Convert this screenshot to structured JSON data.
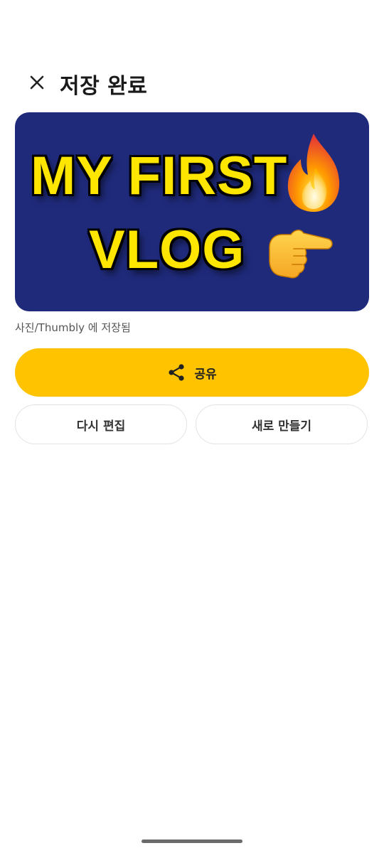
{
  "header": {
    "title": "저장 완료",
    "close_icon": "close-icon"
  },
  "thumbnail": {
    "line1": "MY FIRST",
    "line2": "VLOG",
    "background": "#1f2a7a",
    "text_color": "#ffe600",
    "emoji_icons": [
      "fire-icon",
      "pointing-right-hand-icon"
    ]
  },
  "saved_path": "사진/Thumbly 에 저장됨",
  "actions": {
    "share_label": "공유",
    "share_icon": "share-icon",
    "share_color": "#ffc300",
    "edit_again_label": "다시 편집",
    "create_new_label": "새로 만들기"
  }
}
